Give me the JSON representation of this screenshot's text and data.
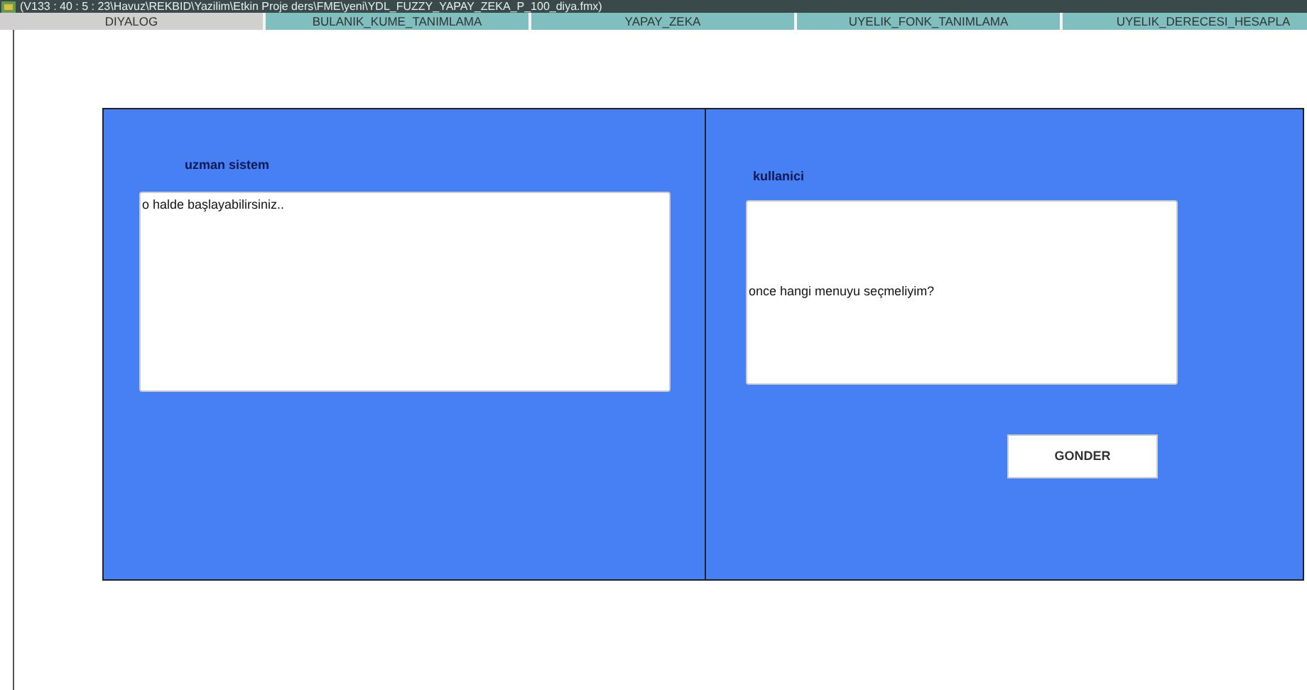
{
  "window": {
    "title": "(V133 : 40 : 5 : 23\\Havuz\\REKBID\\Yazilim\\Etkin Proje ders\\FME\\yeni\\YDL_FUZZY_YAPAY_ZEKA_P_100_diya.fmx)"
  },
  "tabs": [
    {
      "label": "DIYALOG",
      "selected": true
    },
    {
      "label": "BULANIK_KUME_TANIMLAMA",
      "selected": false
    },
    {
      "label": "YAPAY_ZEKA",
      "selected": false
    },
    {
      "label": "UYELIK_FONK_TANIMLAMA",
      "selected": false
    },
    {
      "label": "UYELIK_DERECESI_HESAPLA",
      "selected": false
    }
  ],
  "expert_panel": {
    "label": "uzman sistem",
    "value": "o halde  başlayabilirsiniz.."
  },
  "user_panel": {
    "label": "kullanici",
    "value": "once hangi menuyu seçmeliyim?"
  },
  "send_button": "GONDER"
}
